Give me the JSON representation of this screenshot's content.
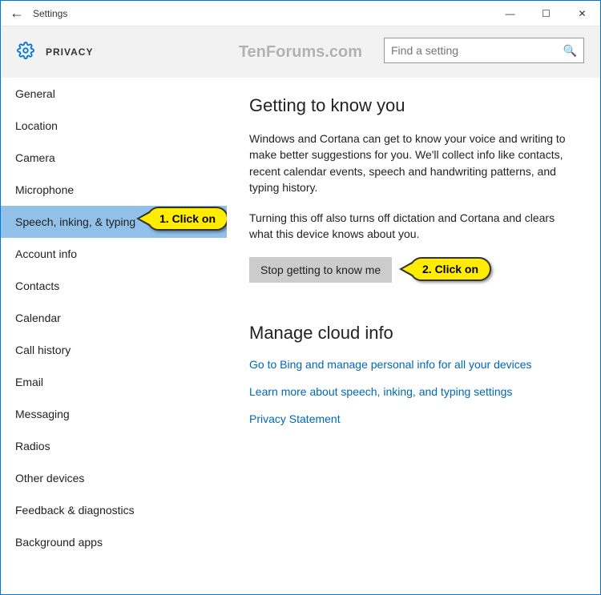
{
  "window": {
    "title": "Settings"
  },
  "header": {
    "crumb": "PRIVACY"
  },
  "search": {
    "placeholder": "Find a setting"
  },
  "sidebar": {
    "items": [
      {
        "label": "General"
      },
      {
        "label": "Location"
      },
      {
        "label": "Camera"
      },
      {
        "label": "Microphone"
      },
      {
        "label": "Speech, inking, & typing"
      },
      {
        "label": "Account info"
      },
      {
        "label": "Contacts"
      },
      {
        "label": "Calendar"
      },
      {
        "label": "Call history"
      },
      {
        "label": "Email"
      },
      {
        "label": "Messaging"
      },
      {
        "label": "Radios"
      },
      {
        "label": "Other devices"
      },
      {
        "label": "Feedback & diagnostics"
      },
      {
        "label": "Background apps"
      }
    ]
  },
  "content": {
    "heading1": "Getting to know you",
    "para1": "Windows and Cortana can get to know your voice and writing to make better suggestions for you. We'll collect info like contacts, recent calendar events, speech and handwriting patterns, and typing history.",
    "para2": "Turning this off also turns off dictation and Cortana and clears what this device knows about you.",
    "button": "Stop getting to know me",
    "heading2": "Manage cloud info",
    "link1": "Go to Bing and manage personal info for all your devices",
    "link2": "Learn more about speech, inking, and typing settings",
    "link3": "Privacy Statement"
  },
  "callouts": {
    "one": "1. Click on",
    "two": "2. Click on"
  },
  "watermark": "TenForums.com"
}
